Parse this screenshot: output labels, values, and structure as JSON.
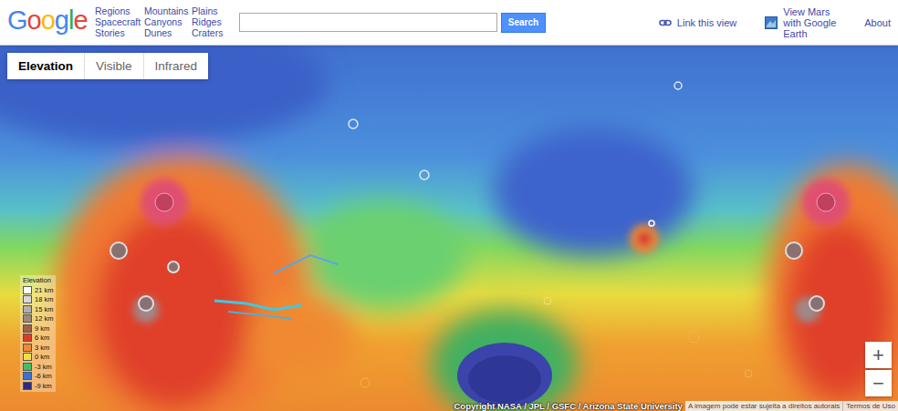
{
  "header": {
    "logo": "Google",
    "nav_columns": [
      [
        "Regions",
        "Spacecraft",
        "Stories"
      ],
      [
        "Mountains",
        "Canyons",
        "Dunes"
      ],
      [
        "Plains",
        "Ridges",
        "Craters"
      ]
    ],
    "search": {
      "button": "Search"
    },
    "links": [
      {
        "kind": "link",
        "label": "Link this view"
      },
      {
        "kind": "earth",
        "label": "View Mars with Google Earth"
      },
      {
        "kind": "plain",
        "label": "About"
      }
    ]
  },
  "map": {
    "tabs": [
      {
        "label": "Elevation",
        "selected": true
      },
      {
        "label": "Visible",
        "selected": false
      },
      {
        "label": "Infrared",
        "selected": false
      }
    ],
    "legend": {
      "title": "Elevation",
      "entries": [
        {
          "label": "21 km",
          "color": "#ffffff"
        },
        {
          "label": "18 km",
          "color": "#d8d8d8"
        },
        {
          "label": "15 km",
          "color": "#b0b0b0"
        },
        {
          "label": "12 km",
          "color": "#9a8a80"
        },
        {
          "label": "9 km",
          "color": "#a0604a"
        },
        {
          "label": "6 km",
          "color": "#e03a2a"
        },
        {
          "label": "3 km",
          "color": "#f08a30"
        },
        {
          "label": "0 km",
          "color": "#f0e040"
        },
        {
          "label": "-3 km",
          "color": "#40c060"
        },
        {
          "label": "-6 km",
          "color": "#3a70d8"
        },
        {
          "label": "-9 km",
          "color": "#2a2a80"
        }
      ]
    },
    "zoom": [
      "+",
      "−"
    ],
    "attribution": {
      "copyright": "Copyright NASA / JPL / GSFC / Arizona State University",
      "notice": "A imagem pode estar sujeita a direitos autorais",
      "terms": "Termos de Uso"
    }
  }
}
